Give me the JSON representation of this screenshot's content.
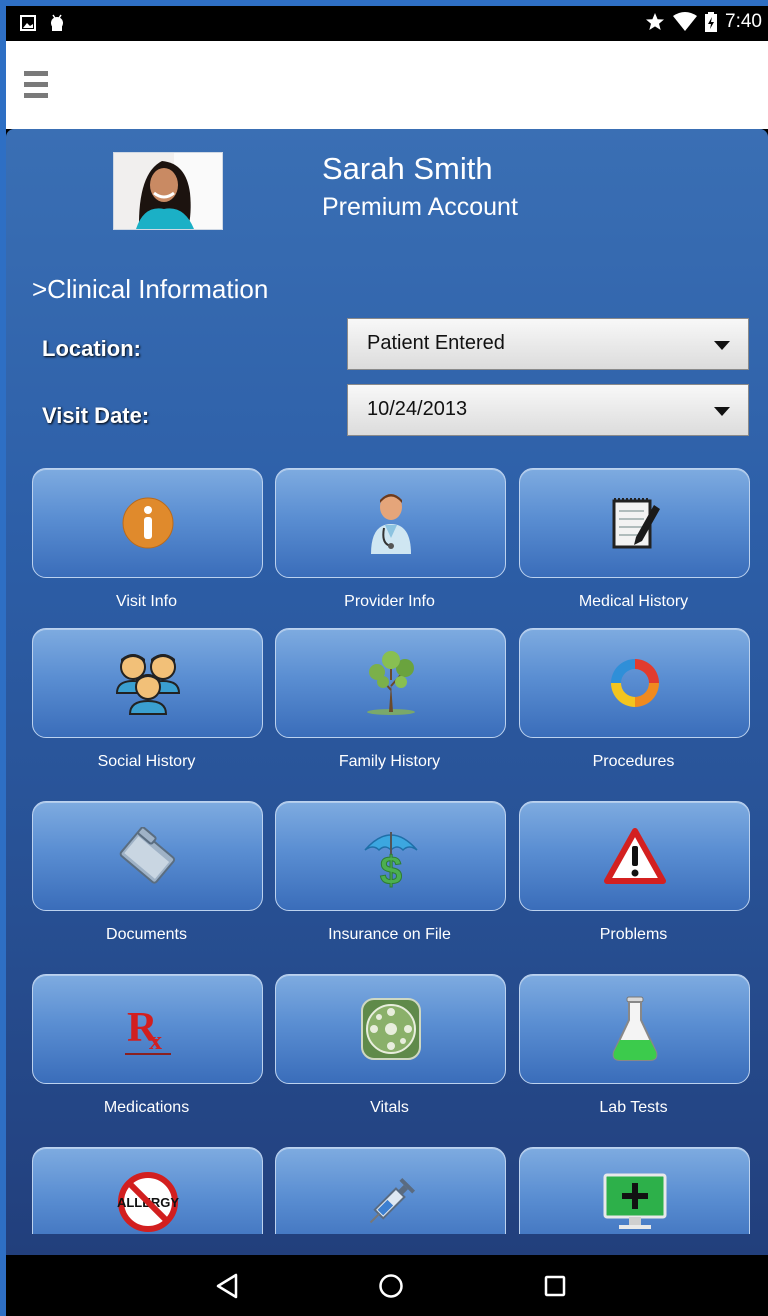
{
  "status_bar": {
    "time": "7:40"
  },
  "user": {
    "name": "Sarah Smith",
    "account": "Premium Account"
  },
  "section_title": ">Clinical Information",
  "fields": {
    "location": {
      "label": "Location:",
      "value": "Patient Entered"
    },
    "visit_date": {
      "label": "Visit Date:",
      "value": "10/24/2013"
    }
  },
  "tiles": [
    {
      "label": "Visit Info",
      "icon": "info-icon"
    },
    {
      "label": "Provider Info",
      "icon": "doctor-icon"
    },
    {
      "label": "Medical History",
      "icon": "notepad-icon"
    },
    {
      "label": "Social History",
      "icon": "people-icon"
    },
    {
      "label": "Family History",
      "icon": "tree-icon"
    },
    {
      "label": "Procedures",
      "icon": "cycle-icon"
    },
    {
      "label": "Documents",
      "icon": "folder-icon"
    },
    {
      "label": "Insurance on File",
      "icon": "insurance-icon"
    },
    {
      "label": "Problems",
      "icon": "warning-icon"
    },
    {
      "label": "Medications",
      "icon": "rx-icon"
    },
    {
      "label": "Vitals",
      "icon": "vitals-icon"
    },
    {
      "label": "Lab Tests",
      "icon": "flask-icon"
    },
    {
      "label": "",
      "icon": "no-allergy-icon",
      "icon_text": "ALLERGY"
    },
    {
      "label": "",
      "icon": "syringe-icon"
    },
    {
      "label": "",
      "icon": "monitor-plus-icon"
    }
  ]
}
